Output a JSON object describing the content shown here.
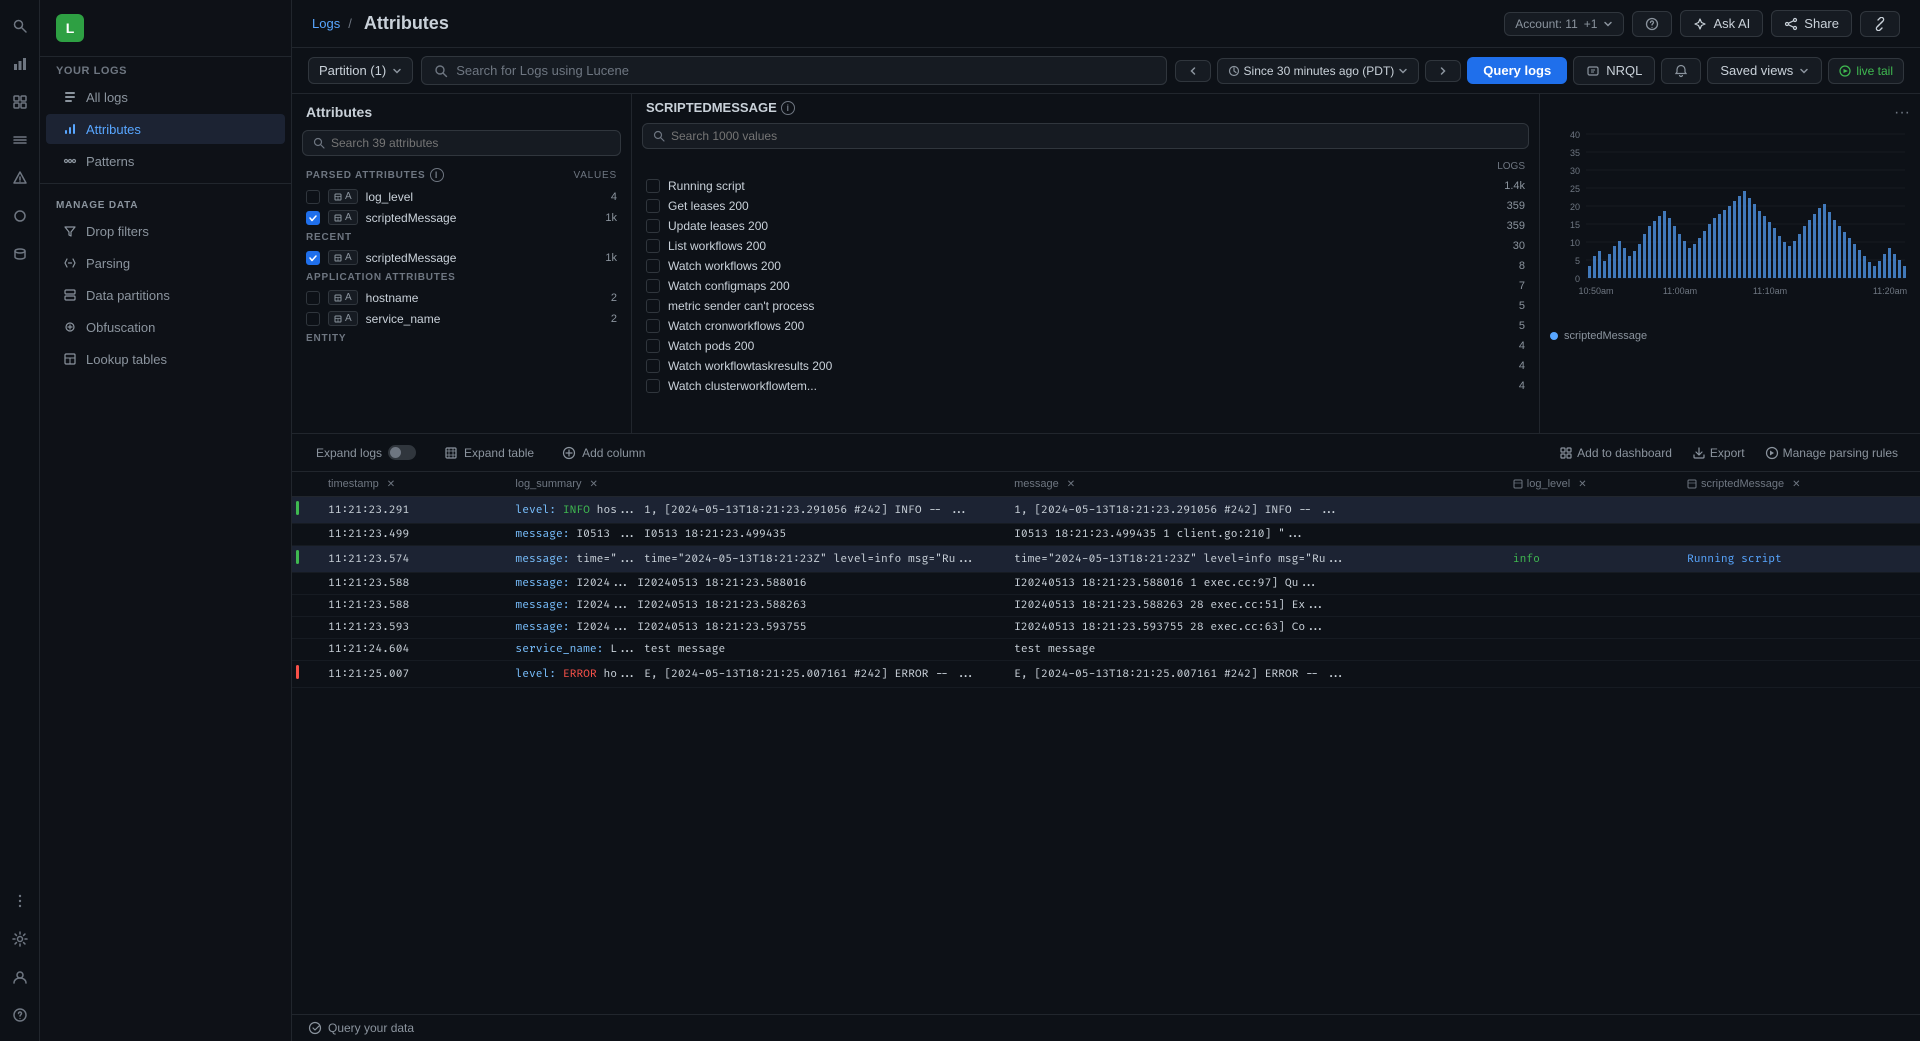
{
  "sidebar": {
    "logo_text": "L",
    "your_logs": "YOUR LOGS",
    "nav_items": [
      {
        "id": "all-logs",
        "label": "All logs",
        "icon": "list-icon",
        "active": false
      },
      {
        "id": "attributes",
        "label": "Attributes",
        "icon": "bar-chart-icon",
        "active": true
      },
      {
        "id": "patterns",
        "label": "Patterns",
        "icon": "pattern-icon",
        "active": false
      }
    ],
    "manage_data": "MANAGE DATA",
    "manage_items": [
      {
        "id": "drop-filters",
        "label": "Drop filters",
        "icon": "filter-icon"
      },
      {
        "id": "parsing",
        "label": "Parsing",
        "icon": "code-icon"
      },
      {
        "id": "data-partitions",
        "label": "Data partitions",
        "icon": "partition-icon"
      },
      {
        "id": "obfuscation",
        "label": "Obfuscation",
        "icon": "obfuscation-icon"
      },
      {
        "id": "lookup-tables",
        "label": "Lookup tables",
        "icon": "table-icon"
      }
    ]
  },
  "topbar": {
    "breadcrumb_link": "Logs",
    "page_title": "Attributes",
    "account_label": "Account: 11",
    "account_extra": "+1",
    "ask_ai_label": "Ask AI",
    "share_label": "Share"
  },
  "toolbar": {
    "partition_label": "Partition (1)",
    "search_placeholder": "Search for Logs using Lucene",
    "time_label": "Since 30 minutes ago (PDT)",
    "query_logs_label": "Query logs",
    "nrql_label": "NRQL",
    "saved_views_label": "Saved views",
    "live_tail_label": "live tail"
  },
  "attributes_panel": {
    "title": "Attributes",
    "search_placeholder": "Search 39 attributes",
    "sections": [
      {
        "title": "PARSED ATTRIBUTES",
        "has_info": true,
        "header_values": "VALUES",
        "items": [
          {
            "name": "log_level",
            "count": "4",
            "checked": false,
            "tag": "A"
          },
          {
            "name": "scriptedMessage",
            "count": "1k",
            "checked": true,
            "tag": "A"
          }
        ]
      },
      {
        "title": "RECENT",
        "items": [
          {
            "name": "scriptedMessage",
            "count": "1k",
            "checked": true,
            "tag": "A"
          }
        ]
      },
      {
        "title": "APPLICATION ATTRIBUTES",
        "items": [
          {
            "name": "hostname",
            "count": "2",
            "checked": false,
            "tag": "A"
          },
          {
            "name": "service_name",
            "count": "2",
            "checked": false,
            "tag": "A"
          }
        ]
      },
      {
        "title": "ENTITY",
        "items": []
      }
    ]
  },
  "values_panel": {
    "title": "SCRIPTEDMESSAGE",
    "search_placeholder": "Search 1000 values",
    "header_logs": "LOGS",
    "items": [
      {
        "name": "Running script",
        "count": "1.4k",
        "checked": false
      },
      {
        "name": "Get leases 200",
        "count": "359",
        "checked": false
      },
      {
        "name": "Update leases 200",
        "count": "359",
        "checked": false
      },
      {
        "name": "List workflows 200",
        "count": "30",
        "checked": false
      },
      {
        "name": "Watch workflows 200",
        "count": "8",
        "checked": false
      },
      {
        "name": "Watch configmaps 200",
        "count": "7",
        "checked": false
      },
      {
        "name": "metric sender can't process",
        "count": "5",
        "checked": false
      },
      {
        "name": "Watch cronworkflows 200",
        "count": "5",
        "checked": false
      },
      {
        "name": "Watch pods 200",
        "count": "4",
        "checked": false
      },
      {
        "name": "Watch workflowtaskresults 200",
        "count": "4",
        "checked": false
      },
      {
        "name": "Watch clusterworkflowtem...",
        "count": "4",
        "checked": false
      }
    ]
  },
  "chart": {
    "y_labels": [
      "40",
      "35",
      "30",
      "25",
      "20",
      "15",
      "10",
      "5",
      "0"
    ],
    "x_labels": [
      "10:50am",
      "11:00am",
      "11:10am",
      "11:20am"
    ],
    "legend": "scriptedMessage"
  },
  "log_toolbar": {
    "expand_logs_label": "Expand logs",
    "expand_table_label": "Expand table",
    "add_column_label": "Add column",
    "add_to_dashboard_label": "Add to dashboard",
    "export_label": "Export",
    "manage_parsing_label": "Manage parsing rules"
  },
  "log_table": {
    "columns": [
      {
        "id": "timestamp",
        "label": "timestamp"
      },
      {
        "id": "log_summary",
        "label": "log_summary"
      },
      {
        "id": "message",
        "label": "message"
      },
      {
        "id": "log_level",
        "label": "log_level"
      },
      {
        "id": "scriptedMessage",
        "label": "scriptedMessage"
      }
    ],
    "rows": [
      {
        "indicator": "info",
        "timestamp": "11:21:23.291",
        "log_summary_prefix": "level: INFO",
        "log_summary_highlight": "hos...",
        "log_summary": "1, [2024-05-13T18:21:23.291056 #242]  INFO -- ...",
        "message": "1, [2024-05-13T18:21:23.291056 #242]  INFO -- ...",
        "log_level": "",
        "scriptedMessage": "",
        "highlighted": true
      },
      {
        "indicator": "none",
        "timestamp": "11:21:23.499",
        "log_summary_prefix": "message: I0513",
        "log_summary": "I0513 18:21:23.499435",
        "message": "I0513 18:21:23.499435       1 client.go:210] \"...",
        "log_level": "",
        "scriptedMessage": ""
      },
      {
        "indicator": "info",
        "timestamp": "11:21:23.574",
        "log_summary_prefix": "message: time=\"...",
        "log_summary": "time=\"2024-05-13T18:21:23Z\" level=info msg=\"Ru...",
        "message": "time=\"2024-05-13T18:21:23Z\" level=info msg=\"Ru...",
        "log_level": "info",
        "scriptedMessage": "Running script",
        "highlighted": true
      },
      {
        "indicator": "none",
        "timestamp": "11:21:23.588",
        "log_summary_prefix": "message: I2024...",
        "log_summary": "I20240513 18:21:23.588016",
        "message": "I20240513 18:21:23.588016       1 exec.cc:97] Qu...",
        "log_level": "",
        "scriptedMessage": ""
      },
      {
        "indicator": "none",
        "timestamp": "11:21:23.588",
        "log_summary_prefix": "message: I2024...",
        "log_summary": "I20240513 18:21:23.588263",
        "message": "I20240513 18:21:23.588263      28 exec.cc:51] Ex...",
        "log_level": "",
        "scriptedMessage": ""
      },
      {
        "indicator": "none",
        "timestamp": "11:21:23.593",
        "log_summary_prefix": "message: I2024...",
        "log_summary": "I20240513 18:21:23.593755",
        "message": "I20240513 18:21:23.593755      28 exec.cc:63] Co...",
        "log_level": "",
        "scriptedMessage": ""
      },
      {
        "indicator": "none",
        "timestamp": "11:21:24.604",
        "log_summary_prefix": "service_name: L...",
        "log_summary": "test message",
        "message": "test message",
        "log_level": "",
        "scriptedMessage": ""
      },
      {
        "indicator": "error",
        "timestamp": "11:21:25.007",
        "log_summary_prefix": "level: ERROR",
        "log_summary_highlight": "ho...",
        "log_summary": "E, [2024-05-13T18:21:25.007161 #242] ERROR -- ...",
        "message": "E, [2024-05-13T18:21:25.007161 #242] ERROR -- ...",
        "log_level": "",
        "scriptedMessage": ""
      }
    ]
  },
  "bottom_bar": {
    "query_data_label": "Query your data"
  },
  "left_icons": [
    {
      "id": "search",
      "icon": "🔍"
    },
    {
      "id": "chart",
      "icon": "📊"
    },
    {
      "id": "grid",
      "icon": "⊞"
    },
    {
      "id": "layers",
      "icon": "≡"
    },
    {
      "id": "bell",
      "icon": "🔔"
    },
    {
      "id": "circle",
      "icon": "●"
    },
    {
      "id": "dots",
      "icon": "⋮"
    },
    {
      "id": "settings",
      "icon": "⚙"
    },
    {
      "id": "user",
      "icon": "👤"
    },
    {
      "id": "info",
      "icon": "?"
    }
  ]
}
